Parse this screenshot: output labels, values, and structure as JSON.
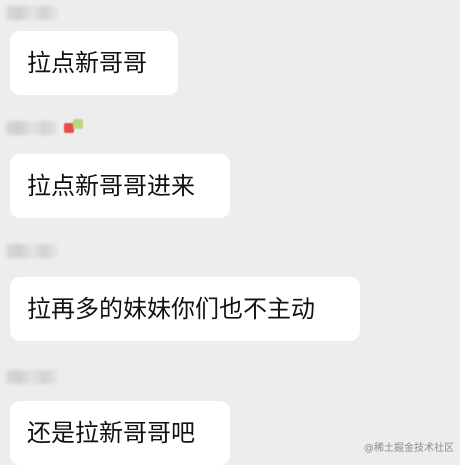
{
  "messages": [
    {
      "text": "拉点新哥哥",
      "sender_blurred": true,
      "sender_emoji": false
    },
    {
      "text": "拉点新哥哥进来",
      "sender_blurred": true,
      "sender_emoji": true
    },
    {
      "text": "拉再多的妹妹你们也不主动",
      "sender_blurred": true,
      "sender_emoji": false
    },
    {
      "text": "还是拉新哥哥吧",
      "sender_blurred": true,
      "sender_emoji": false
    }
  ],
  "watermark": "@稀土掘金技术社区",
  "colors": {
    "background": "#ededed",
    "bubble": "#ffffff",
    "text": "#111111"
  }
}
